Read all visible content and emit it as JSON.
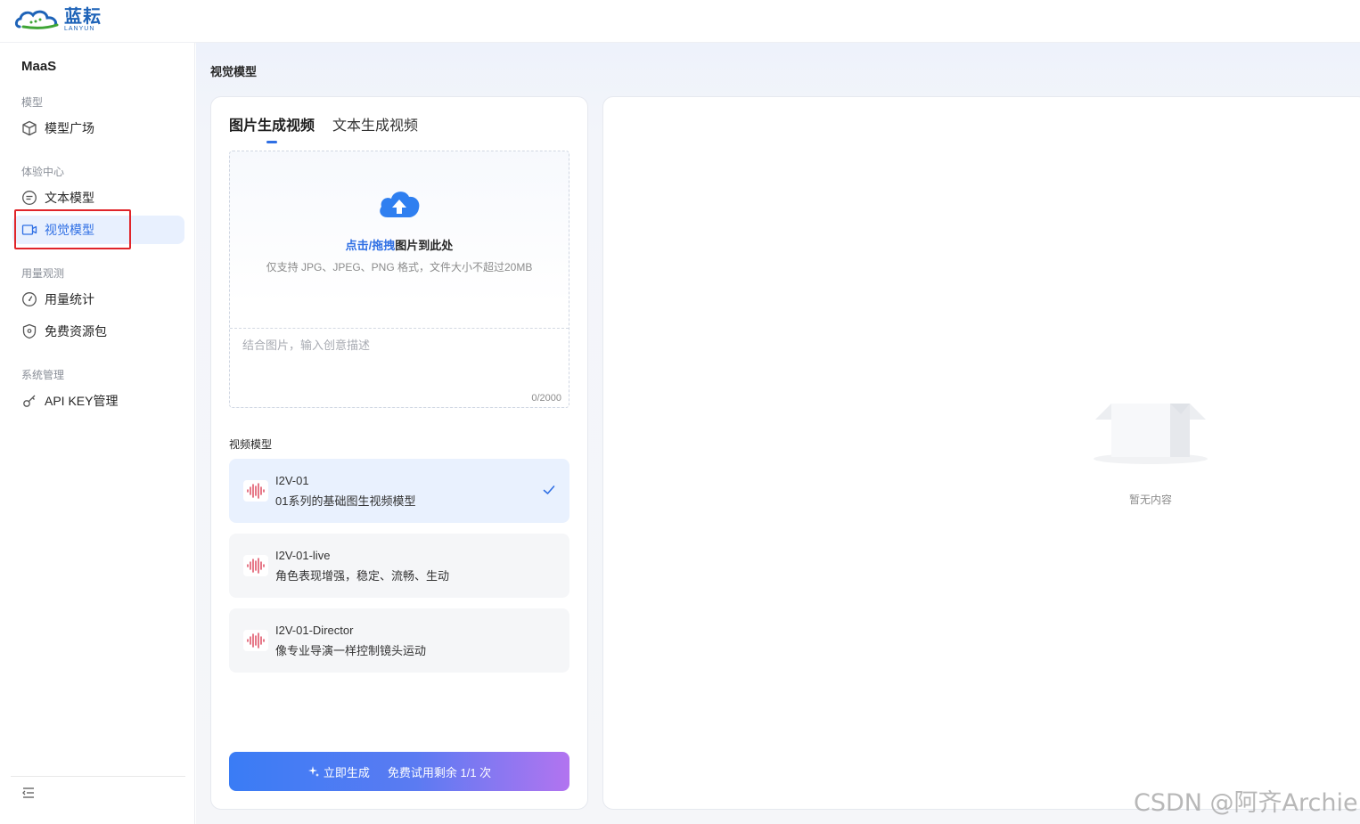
{
  "header": {
    "logo_cn": "蓝耘",
    "logo_en": "LANYUN"
  },
  "sidebar": {
    "brand": "MaaS",
    "groups": [
      {
        "label": "模型",
        "items": [
          {
            "label": "模型广场",
            "icon": "cube-icon"
          }
        ]
      },
      {
        "label": "体验中心",
        "items": [
          {
            "label": "文本模型",
            "icon": "chat-icon"
          },
          {
            "label": "视觉模型",
            "icon": "video-icon",
            "active": true
          }
        ]
      },
      {
        "label": "用量观测",
        "items": [
          {
            "label": "用量统计",
            "icon": "gauge-icon"
          },
          {
            "label": "免费资源包",
            "icon": "shield-icon"
          }
        ]
      },
      {
        "label": "系统管理",
        "items": [
          {
            "label": "API KEY管理",
            "icon": "key-icon"
          }
        ]
      }
    ]
  },
  "main": {
    "page_title": "视觉模型",
    "tabs": [
      {
        "label": "图片生成视频",
        "active": true
      },
      {
        "label": "文本生成视频",
        "active": false
      }
    ],
    "upload": {
      "link_text": "点击/拖拽",
      "main_text": "图片到此处",
      "hint": "仅支持 JPG、JPEG、PNG 格式，文件大小不超过20MB"
    },
    "prompt": {
      "placeholder": "结合图片，输入创意描述",
      "value": "",
      "counter": "0/2000"
    },
    "model_section_label": "视频模型",
    "models": [
      {
        "name": "I2V-01",
        "desc": "01系列的基础图生视频模型",
        "selected": true
      },
      {
        "name": "I2V-01-live",
        "desc": "角色表现增强，稳定、流畅、生动",
        "selected": false
      },
      {
        "name": "I2V-01-Director",
        "desc": "像专业导演一样控制镜头运动",
        "selected": false
      }
    ],
    "generate_button": {
      "label": "立即生成",
      "quota": "免费试用剩余 1/1 次"
    },
    "empty_state": "暂无内容"
  },
  "watermark": "CSDN @阿齐Archie",
  "colors": {
    "accent": "#2f6fe4",
    "highlight_box": "#e0252a",
    "button_gradient_start": "#3a7cf5",
    "button_gradient_end": "#b274f0"
  }
}
